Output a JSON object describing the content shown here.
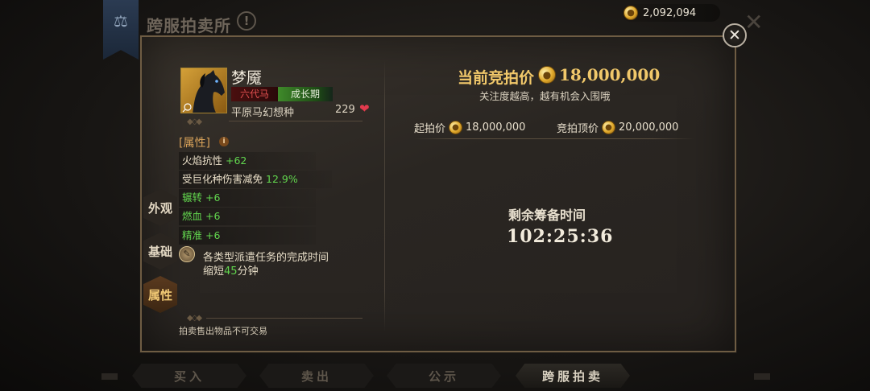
{
  "header": {
    "title": "跨服拍卖所",
    "help_glyph": "!",
    "gold_amount": "2,092,094"
  },
  "item": {
    "name": "梦魇",
    "generation_tag": "六代马",
    "stage_tag": "成长期",
    "breed": "平原马幻想种",
    "count": "229"
  },
  "attributes": {
    "title": "[属性]",
    "info_glyph": "i",
    "stats": [
      {
        "label": "火焰抗性",
        "value": "+62"
      },
      {
        "label": "受巨化种伤害减免",
        "value": "12.9%"
      },
      {
        "label": "辗转",
        "value": "+6"
      },
      {
        "label": "燃血",
        "value": "+6"
      },
      {
        "label": "精准",
        "value": "+6"
      }
    ],
    "skill_line1": "各类型派遣任务的完成时间",
    "skill_line2_prefix": "缩短",
    "skill_line2_value": "45",
    "skill_line2_suffix": "分钟"
  },
  "note": "拍卖售出物品不可交易",
  "side_tabs": [
    {
      "label": "外观",
      "active": false
    },
    {
      "label": "基础",
      "active": false
    },
    {
      "label": "属性",
      "active": true
    }
  ],
  "auction": {
    "current_bid_label": "当前竞拍价",
    "current_bid_value": "18,000,000",
    "hint": "关注度越高，越有机会入围哦",
    "start_label": "起拍价",
    "start_value": "18,000,000",
    "cap_label": "竞拍顶价",
    "cap_value": "20,000,000",
    "time_label": "剩余筹备时间",
    "time_value": "102:25:36"
  },
  "bottom_tabs": [
    {
      "label": "买入",
      "active": false
    },
    {
      "label": "卖出",
      "active": false
    },
    {
      "label": "公示",
      "active": false
    },
    {
      "label": "跨服拍卖",
      "active": true
    }
  ],
  "colors": {
    "accent_gold": "#f1c86a",
    "stat_green": "#62d64e",
    "gen_red": "#e25050",
    "active_tab": "#f0c874"
  },
  "icons": [
    "scale-icon",
    "help-icon",
    "gold-coin-icon",
    "close-icon",
    "horse-portrait-icon",
    "heart-icon",
    "info-icon",
    "skill-icon"
  ]
}
